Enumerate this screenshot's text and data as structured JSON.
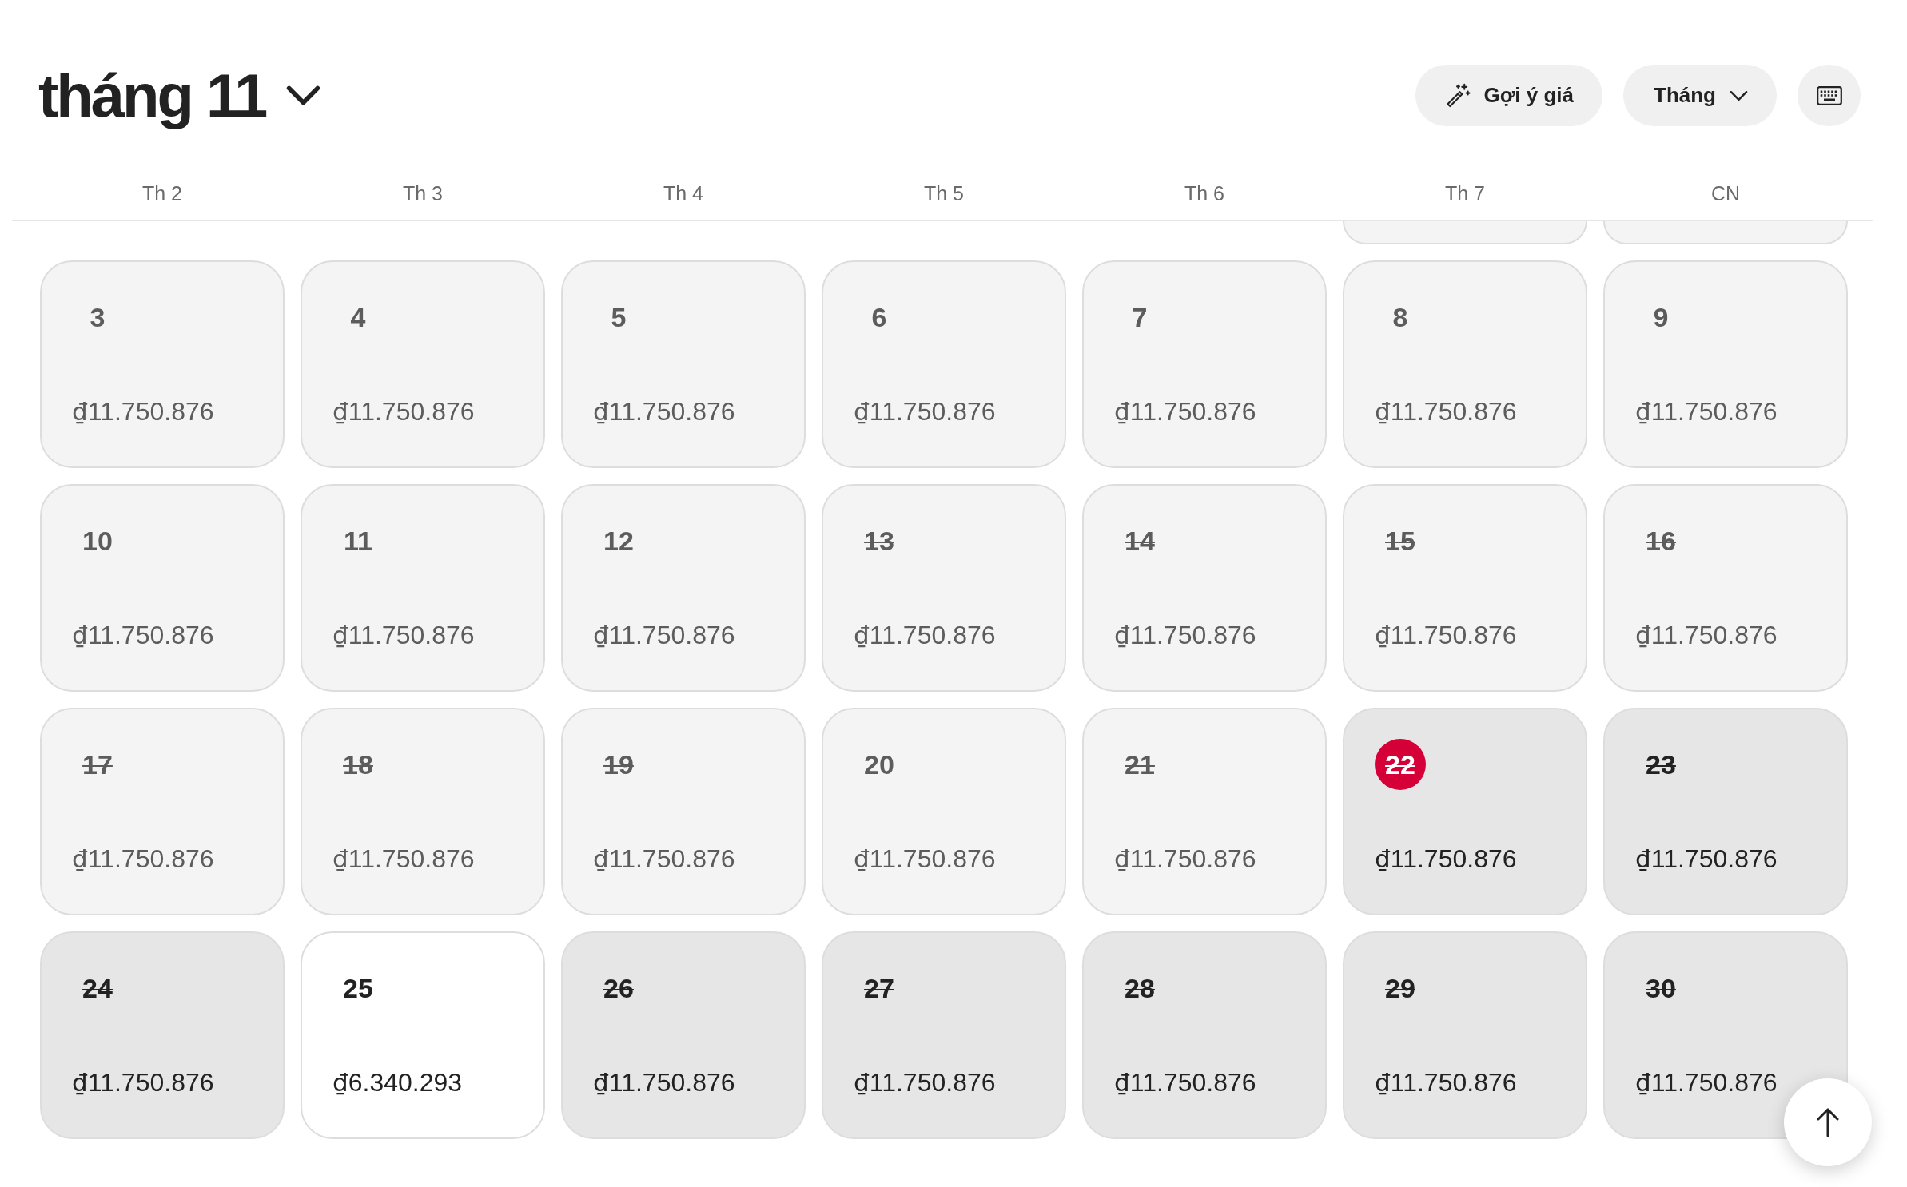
{
  "header": {
    "month_title": "tháng 11",
    "buttons": [
      {
        "kind": "suggest",
        "label": "Gợi ý giá"
      },
      {
        "kind": "dropdown",
        "label": "Tháng"
      },
      {
        "kind": "keyboard"
      }
    ]
  },
  "weekdays": [
    "Th 2",
    "Th 3",
    "Th 4",
    "Th 5",
    "Th 6",
    "Th 7",
    "CN"
  ],
  "weeks": [
    {
      "days": [
        {
          "kind": "blank"
        },
        {
          "kind": "blank"
        },
        {
          "kind": "blank"
        },
        {
          "kind": "blank"
        },
        {
          "kind": "blank"
        },
        {
          "kind": "clipped"
        },
        {
          "kind": "clipped"
        }
      ]
    },
    {
      "days": [
        {
          "kind": "day",
          "day": "3",
          "price": "₫11.750.876",
          "dimmed": true,
          "blocked": false,
          "today": false
        },
        {
          "kind": "day",
          "day": "4",
          "price": "₫11.750.876",
          "dimmed": true,
          "blocked": false,
          "today": false
        },
        {
          "kind": "day",
          "day": "5",
          "price": "₫11.750.876",
          "dimmed": true,
          "blocked": false,
          "today": false
        },
        {
          "kind": "day",
          "day": "6",
          "price": "₫11.750.876",
          "dimmed": true,
          "blocked": false,
          "today": false
        },
        {
          "kind": "day",
          "day": "7",
          "price": "₫11.750.876",
          "dimmed": true,
          "blocked": false,
          "today": false
        },
        {
          "kind": "day",
          "day": "8",
          "price": "₫11.750.876",
          "dimmed": true,
          "blocked": false,
          "today": false
        },
        {
          "kind": "day",
          "day": "9",
          "price": "₫11.750.876",
          "dimmed": true,
          "blocked": false,
          "today": false
        }
      ]
    },
    {
      "days": [
        {
          "kind": "day",
          "day": "10",
          "price": "₫11.750.876",
          "dimmed": true,
          "blocked": false,
          "today": false
        },
        {
          "kind": "day",
          "day": "11",
          "price": "₫11.750.876",
          "dimmed": true,
          "blocked": false,
          "today": false
        },
        {
          "kind": "day",
          "day": "12",
          "price": "₫11.750.876",
          "dimmed": true,
          "blocked": false,
          "today": false
        },
        {
          "kind": "day",
          "day": "13",
          "price": "₫11.750.876",
          "dimmed": true,
          "blocked": true,
          "today": false
        },
        {
          "kind": "day",
          "day": "14",
          "price": "₫11.750.876",
          "dimmed": true,
          "blocked": true,
          "today": false
        },
        {
          "kind": "day",
          "day": "15",
          "price": "₫11.750.876",
          "dimmed": true,
          "blocked": true,
          "today": false
        },
        {
          "kind": "day",
          "day": "16",
          "price": "₫11.750.876",
          "dimmed": true,
          "blocked": true,
          "today": false
        }
      ]
    },
    {
      "days": [
        {
          "kind": "day",
          "day": "17",
          "price": "₫11.750.876",
          "dimmed": true,
          "blocked": true,
          "today": false
        },
        {
          "kind": "day",
          "day": "18",
          "price": "₫11.750.876",
          "dimmed": true,
          "blocked": true,
          "today": false
        },
        {
          "kind": "day",
          "day": "19",
          "price": "₫11.750.876",
          "dimmed": true,
          "blocked": true,
          "today": false
        },
        {
          "kind": "day",
          "day": "20",
          "price": "₫11.750.876",
          "dimmed": true,
          "blocked": false,
          "today": false
        },
        {
          "kind": "day",
          "day": "21",
          "price": "₫11.750.876",
          "dimmed": true,
          "blocked": true,
          "today": false
        },
        {
          "kind": "day",
          "day": "22",
          "price": "₫11.750.876",
          "dimmed": false,
          "blocked": true,
          "today": true
        },
        {
          "kind": "day",
          "day": "23",
          "price": "₫11.750.876",
          "dimmed": false,
          "blocked": true,
          "today": false
        }
      ]
    },
    {
      "days": [
        {
          "kind": "day",
          "day": "24",
          "price": "₫11.750.876",
          "dimmed": false,
          "blocked": true,
          "today": false
        },
        {
          "kind": "day",
          "day": "25",
          "price": "₫6.340.293",
          "dimmed": false,
          "blocked": false,
          "today": false
        },
        {
          "kind": "day",
          "day": "26",
          "price": "₫11.750.876",
          "dimmed": false,
          "blocked": true,
          "today": false
        },
        {
          "kind": "day",
          "day": "27",
          "price": "₫11.750.876",
          "dimmed": false,
          "blocked": true,
          "today": false
        },
        {
          "kind": "day",
          "day": "28",
          "price": "₫11.750.876",
          "dimmed": false,
          "blocked": true,
          "today": false
        },
        {
          "kind": "day",
          "day": "29",
          "price": "₫11.750.876",
          "dimmed": false,
          "blocked": true,
          "today": false
        },
        {
          "kind": "day",
          "day": "30",
          "price": "₫11.750.876",
          "dimmed": false,
          "blocked": true,
          "today": false
        }
      ]
    }
  ]
}
